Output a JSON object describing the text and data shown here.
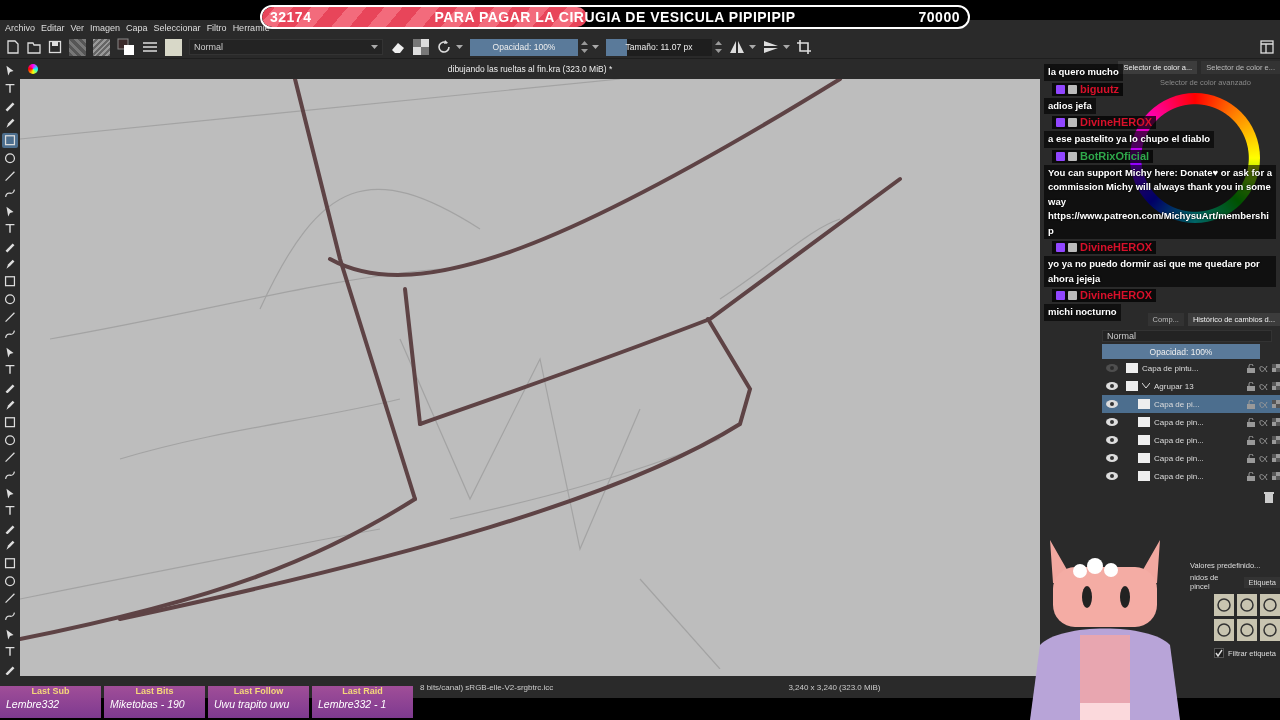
{
  "goal_bar": {
    "current": "32174",
    "title": "PARA PAGAR LA CIRUGIA DE VESICULA PIPIPIPIP",
    "target": "70000",
    "level": 0.46
  },
  "menu": [
    "Archivo",
    "Editar",
    "Ver",
    "Imagen",
    "Capa",
    "Seleccionar",
    "Filtro",
    "Herramie"
  ],
  "toolbar": {
    "blend_mode": "Normal",
    "opacity": {
      "label": "Opacidad: 100%",
      "level": 1
    },
    "size": {
      "label": "Tamaño: 11.07 px",
      "level": 0.2
    }
  },
  "document_title": "dibujando las rueltas al fin.kra (323.0 MiB) *",
  "tools": [
    {
      "selected": false
    },
    {
      "selected": false
    },
    {
      "selected": false
    },
    {
      "selected": false
    },
    {
      "selected": true
    },
    {
      "selected": false
    },
    {
      "selected": false
    },
    {
      "selected": false
    },
    {
      "selected": false
    },
    {
      "selected": false
    },
    {
      "selected": false
    },
    {
      "selected": false
    },
    {
      "selected": false
    },
    {
      "selected": false
    },
    {
      "selected": false
    },
    {
      "selected": false
    },
    {
      "selected": false
    },
    {
      "selected": false
    },
    {
      "selected": false
    },
    {
      "selected": false
    },
    {
      "selected": false
    },
    {
      "selected": false
    },
    {
      "selected": false
    },
    {
      "selected": false
    },
    {
      "selected": false
    },
    {
      "selected": false
    },
    {
      "selected": false
    },
    {
      "selected": false
    },
    {
      "selected": false
    },
    {
      "selected": false
    },
    {
      "selected": false
    },
    {
      "selected": false
    },
    {
      "selected": false
    },
    {
      "selected": false
    },
    {
      "selected": false
    }
  ],
  "color_docker": {
    "tabs": [
      {
        "label": "Selector de color a...",
        "selected": true
      },
      {
        "label": "Selector de color e...",
        "selected": false
      }
    ],
    "title": "Selector de color avanzado"
  },
  "chat": [
    {
      "text": "la quero mucho"
    },
    {
      "user": "biguutz",
      "kind": "user",
      "text": "adios jefa"
    },
    {
      "user": "DivineHEROX",
      "kind": "user",
      "text": "a ese pastelito ya lo chupo el diablo"
    },
    {
      "user": "BotRixOficial",
      "kind": "bot",
      "text": "You can support Michy here: Donate♥ or ask for a commission Michy will always thank you in some way https://www.patreon.com/MichysuArt/membership"
    },
    {
      "user": "DivineHEROX",
      "kind": "user",
      "text": "yo ya no puedo dormir asi que me quedare por ahora jejeja"
    },
    {
      "user": "DivineHEROX",
      "kind": "user",
      "text": "michi nocturno"
    }
  ],
  "layers_docker": {
    "tabs": [
      {
        "label": "Comp...",
        "selected": false
      },
      {
        "label": "Histórico de cambios d...",
        "selected": true
      }
    ],
    "blend_mode": "Normal",
    "opacity": {
      "label": "Opacidad: 100%",
      "level": 1
    },
    "layers": [
      {
        "name": "Capa de pintu...",
        "visible": false,
        "selected": false
      },
      {
        "name": "Agrupar 13",
        "visible": true,
        "selected": false,
        "expanded": true,
        "children": [
          {
            "name": "Capa de pi...",
            "visible": true,
            "selected": true
          },
          {
            "name": "Capa de pin...",
            "visible": true,
            "selected": false
          },
          {
            "name": "Capa de pin...",
            "visible": true,
            "selected": false
          },
          {
            "name": "Capa de pin...",
            "visible": true,
            "selected": false
          },
          {
            "name": "Capa de pin...",
            "visible": true,
            "selected": false
          }
        ]
      }
    ]
  },
  "brush_docker": {
    "header": "Valores predefinido...",
    "title": "nidos de pincel",
    "tag": "Etiqueta",
    "filter_label": "Filtrar etiqueta",
    "filter_checked": true
  },
  "status_bar": {
    "color_info": "8 bits/canal)  sRGB-elle-V2-srgbtrc.icc",
    "dimensions": "3,240 x 3,240 (323.0 MiB)"
  },
  "stream_stats": [
    {
      "label": "Last Sub",
      "value": "Lembre332"
    },
    {
      "label": "Last Bits",
      "value": "Miketobas - 190"
    },
    {
      "label": "Last Follow",
      "value": "Uwu trapito uwu"
    },
    {
      "label": "Last Raid",
      "value": "Lembre332 - 1"
    }
  ]
}
